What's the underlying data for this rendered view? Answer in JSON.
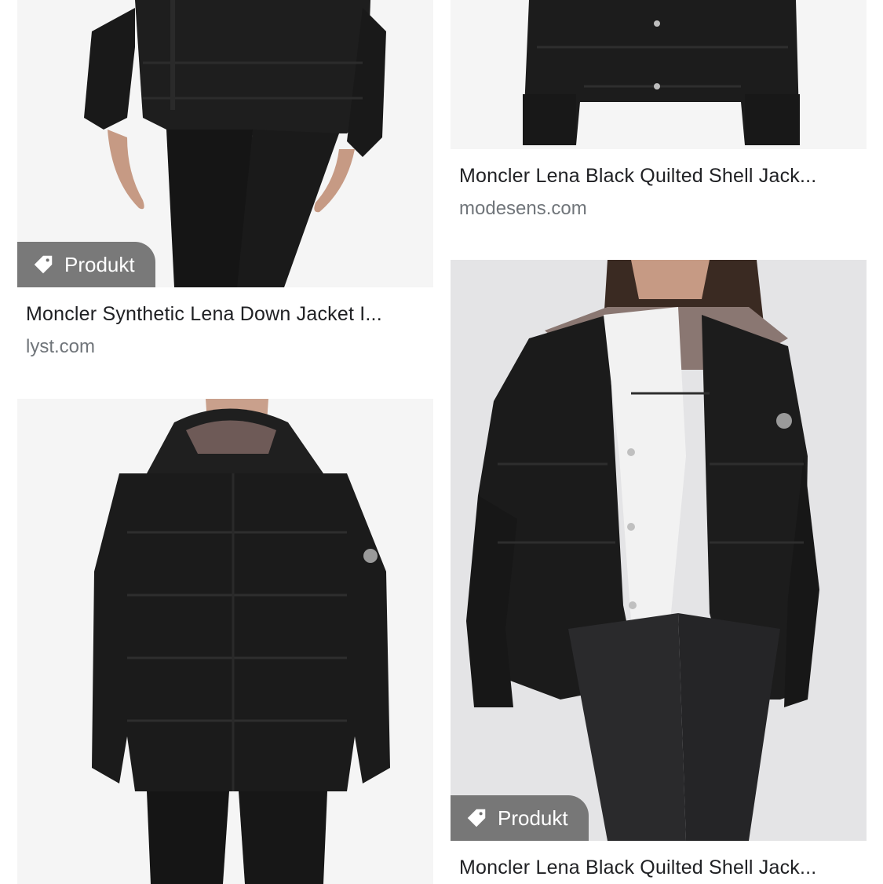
{
  "results": [
    {
      "title": "Moncler Synthetic Lena Down Jacket I...",
      "source": "lyst.com",
      "badge": "Produkt"
    },
    {
      "title": "Moncler Lena Black Quilted Shell Jack...",
      "source": "modesens.com",
      "badge": ""
    },
    {
      "title": "",
      "source": "",
      "badge": ""
    },
    {
      "title": "Moncler Lena Black Quilted Shell Jack...",
      "source": "",
      "badge": "Produkt"
    }
  ],
  "icons": {
    "badge_icon": "tag-icon"
  },
  "colors": {
    "badge_bg": "#6e6e6e",
    "title_text": "#202124",
    "source_text": "#70757a",
    "jacket": "#1b1b1b",
    "background_light": "#f4f4f4"
  }
}
